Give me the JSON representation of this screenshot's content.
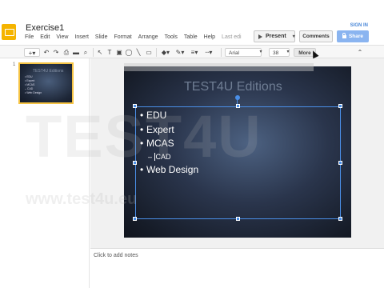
{
  "header": {
    "doc_title": "Exercise1",
    "sign_in": "SIGN IN",
    "menu": [
      "File",
      "Edit",
      "View",
      "Insert",
      "Slide",
      "Format",
      "Arrange",
      "Tools",
      "Table",
      "Help"
    ],
    "last_edit": "Last edi",
    "present_label": "Present",
    "comments_label": "Comments",
    "share_label": "Share"
  },
  "toolbar": {
    "font": "Arial",
    "size": "38",
    "more_label": "More",
    "caret": "▾"
  },
  "filmstrip": {
    "slide_number": "1",
    "thumb_title": "TEST4U Editions",
    "thumb_items": [
      "• EDU",
      "• Expert",
      "• MCAS",
      "  – CAD",
      "• Web Design"
    ]
  },
  "slide": {
    "title": "TEST4U Editions",
    "bullets": [
      "EDU",
      "Expert",
      "MCAS"
    ],
    "sub_bullet": "CAD",
    "last_bullet": "Web Design"
  },
  "watermark": {
    "big": "TEST4U",
    "url": "www.test4u.eu"
  },
  "notes": {
    "placeholder": "Click to add notes"
  },
  "colors": {
    "accent": "#4a8fe8",
    "logo": "#f5b400",
    "share": "#8ab4f0",
    "thumb_border": "#f5c344"
  }
}
